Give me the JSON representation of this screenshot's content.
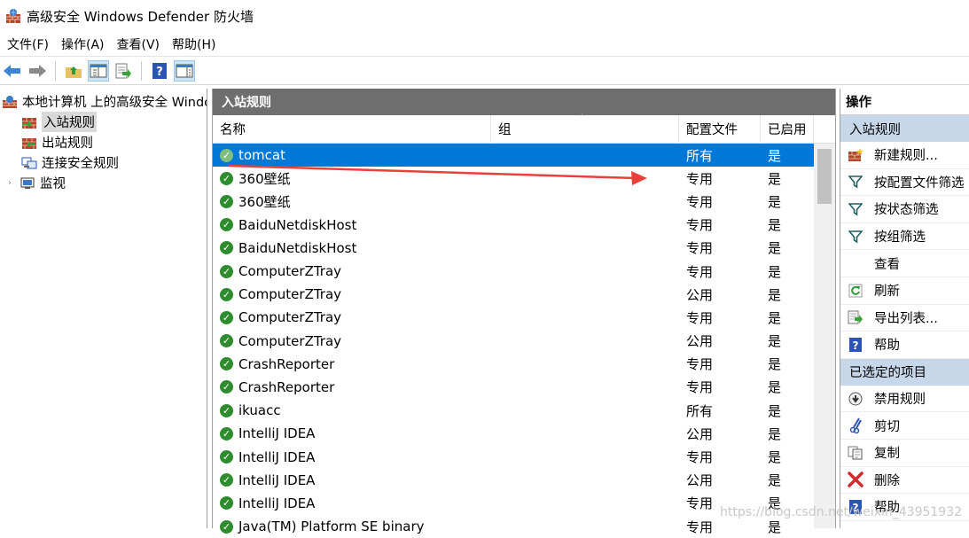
{
  "window": {
    "title": "高级安全 Windows Defender 防火墙"
  },
  "menu": [
    "文件(F)",
    "操作(A)",
    "查看(V)",
    "帮助(H)"
  ],
  "toolbar": [
    "back-arrow-icon",
    "forward-arrow-icon",
    "up-folder-icon",
    "show-hide-tree-icon",
    "export-icon",
    "help-icon",
    "show-hide-action-pane-icon"
  ],
  "tree": {
    "root": "本地计算机 上的高级安全 Windows Defender 防火墙",
    "items": [
      {
        "label": "入站规则",
        "selected": true
      },
      {
        "label": "出站规则"
      },
      {
        "label": "连接安全规则"
      },
      {
        "label": "监视",
        "expandable": true
      }
    ]
  },
  "center": {
    "header": "入站规则",
    "columns": {
      "name": "名称",
      "group": "组",
      "profile": "配置文件",
      "enabled": "已启用"
    },
    "rows": [
      {
        "name": "tomcat",
        "profile": "所有",
        "enabled": "是",
        "selected": true
      },
      {
        "name": "360壁纸",
        "profile": "专用",
        "enabled": "是"
      },
      {
        "name": "360壁纸",
        "profile": "专用",
        "enabled": "是"
      },
      {
        "name": "BaiduNetdiskHost",
        "profile": "专用",
        "enabled": "是"
      },
      {
        "name": "BaiduNetdiskHost",
        "profile": "专用",
        "enabled": "是"
      },
      {
        "name": "ComputerZTray",
        "profile": "专用",
        "enabled": "是"
      },
      {
        "name": "ComputerZTray",
        "profile": "公用",
        "enabled": "是"
      },
      {
        "name": "ComputerZTray",
        "profile": "专用",
        "enabled": "是"
      },
      {
        "name": "ComputerZTray",
        "profile": "公用",
        "enabled": "是"
      },
      {
        "name": "CrashReporter",
        "profile": "专用",
        "enabled": "是"
      },
      {
        "name": "CrashReporter",
        "profile": "专用",
        "enabled": "是"
      },
      {
        "name": "ikuacc",
        "profile": "所有",
        "enabled": "是"
      },
      {
        "name": "IntelliJ IDEA",
        "profile": "公用",
        "enabled": "是"
      },
      {
        "name": "IntelliJ IDEA",
        "profile": "专用",
        "enabled": "是"
      },
      {
        "name": "IntelliJ IDEA",
        "profile": "公用",
        "enabled": "是"
      },
      {
        "name": "IntelliJ IDEA",
        "profile": "专用",
        "enabled": "是"
      },
      {
        "name": "Java(TM) Platform SE binary",
        "profile": "专用",
        "enabled": "是"
      }
    ]
  },
  "actions": {
    "title": "操作",
    "section1": "入站规则",
    "items1": [
      {
        "label": "新建规则...",
        "icon": "new-rule-icon"
      },
      {
        "label": "按配置文件筛选",
        "icon": "filter-icon"
      },
      {
        "label": "按状态筛选",
        "icon": "filter-icon"
      },
      {
        "label": "按组筛选",
        "icon": "filter-icon"
      },
      {
        "label": "查看",
        "icon": ""
      },
      {
        "label": "刷新",
        "icon": "refresh-icon"
      },
      {
        "label": "导出列表...",
        "icon": "export-icon"
      },
      {
        "label": "帮助",
        "icon": "help-icon"
      }
    ],
    "section2": "已选定的项目",
    "items2": [
      {
        "label": "禁用规则",
        "icon": "disable-icon"
      },
      {
        "label": "剪切",
        "icon": "cut-icon"
      },
      {
        "label": "复制",
        "icon": "copy-icon"
      },
      {
        "label": "删除",
        "icon": "delete-icon"
      },
      {
        "label": "帮助",
        "icon": "help-icon"
      }
    ]
  },
  "watermark": "https://blog.csdn.net/weixin_43951932",
  "colors": {
    "selection": "#0078d7",
    "header": "#6e6e6e",
    "section": "#c7d7ea",
    "annotation_arrow": "#e8413c"
  }
}
